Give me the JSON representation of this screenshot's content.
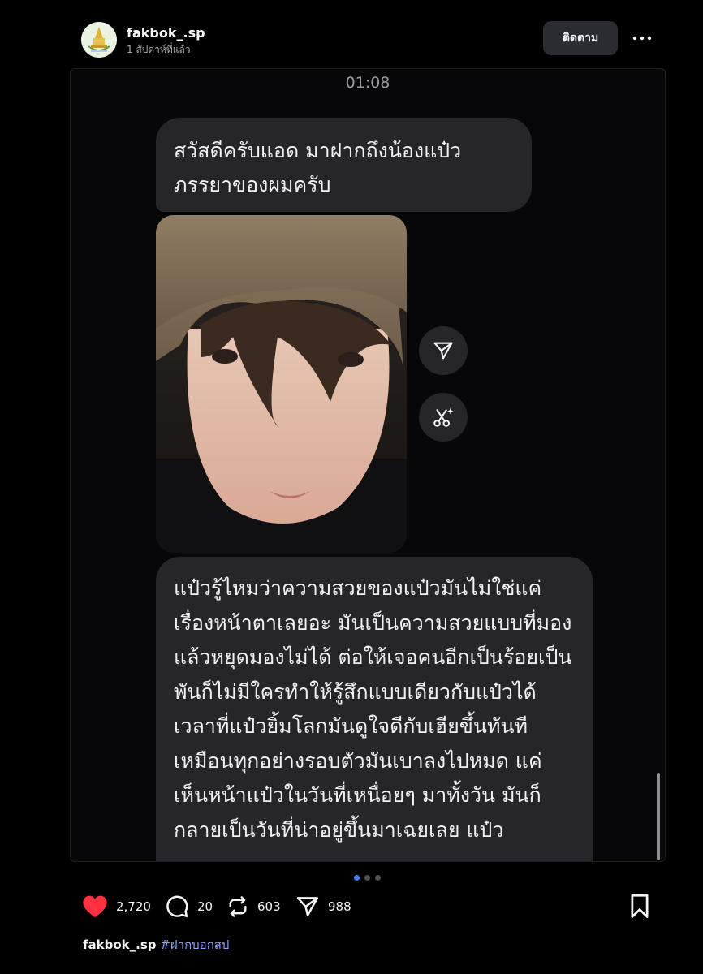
{
  "header": {
    "username": "fakbok_.sp",
    "time_ago": "1 สัปดาห์ที่แล้ว",
    "follow_label": "ติดตาม",
    "more_icon": "more-horizontal-icon"
  },
  "chat": {
    "time": "01:08",
    "message_1": "สวัสดีครับแอด มาฝากถึงน้องแป๋ว ภรรยาของผมครับ",
    "message_2": "แป๋วรู้ไหมว่าความสวยของแป๋วมันไม่ใช่แค่เรื่องหน้าตาเลยอะ มันเป็นความสวยแบบที่มองแล้วหยุดมองไม่ได้ ต่อให้เจอคนอีกเป็นร้อยเป็นพันก็ไม่มีใครทำให้รู้สึกแบบเดียวกับแป๋วได้ เวลาที่แป๋วยิ้มโลกมันดูใจดีกับเฮียขึ้นทันที เหมือนทุกอย่างรอบตัวมันเบาลงไปหมด แค่เห็นหน้าแป๋วในวันที่เหนื่อยๆ มาทั้งวัน มันก็กลายเป็นวันที่น่าอยู่ขึ้นมาเฉยเลย แป๋ว",
    "share_icon": "send-icon",
    "ai_icon": "ai-remix-icon"
  },
  "carousel": {
    "count": 3,
    "active_index": 0
  },
  "actions": {
    "likes": "2,720",
    "comments": "20",
    "reposts": "603",
    "shares": "988"
  },
  "caption": {
    "username": "fakbok_.sp",
    "hashtag": "#ฝากบอกสป"
  },
  "colors": {
    "background": "#000000",
    "bubble": "#26262a",
    "like_red": "#ff3040",
    "link_blue": "#8fa2ff",
    "dot_active": "#4a7ef7"
  }
}
